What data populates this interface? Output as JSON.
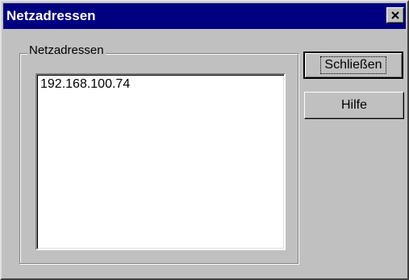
{
  "window": {
    "title": "Netzadressen",
    "close_glyph": "close-icon"
  },
  "group": {
    "legend": "Netzadressen"
  },
  "list": {
    "items": [
      "192.168.100.74"
    ]
  },
  "buttons": {
    "close_label": "Schließen",
    "help_label": "Hilfe"
  },
  "colors": {
    "titlebar": "#000080",
    "face": "#c0c0c0",
    "list_bg": "#ffffff"
  }
}
